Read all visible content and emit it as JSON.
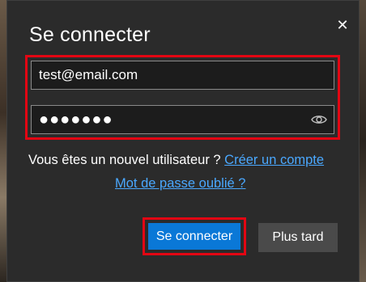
{
  "dialog": {
    "title": "Se connecter",
    "close_icon": "close-icon"
  },
  "form": {
    "email_value": "test@email.com",
    "password_value": "●●●●●●●",
    "password_reveal_icon": "eye-icon"
  },
  "signup": {
    "prompt": "Vous êtes un nouvel utilisateur ?",
    "link": "Créer un compte"
  },
  "forgot_password": "Mot de passe oublié ?",
  "buttons": {
    "sign_in": "Se connecter",
    "later": "Plus tard"
  },
  "colors": {
    "highlight": "#e30613",
    "primary": "#0a78d7",
    "link": "#4aa8ff"
  }
}
